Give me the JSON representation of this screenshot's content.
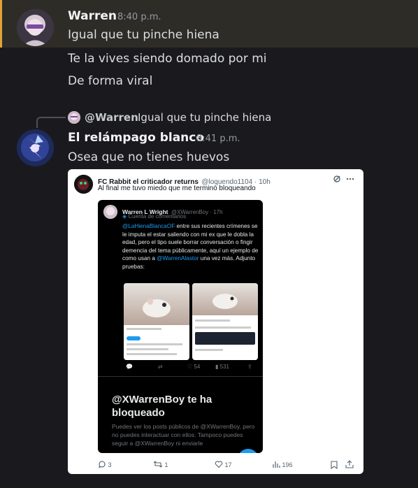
{
  "message1": {
    "author": "Warren",
    "time": "8:40 p.m.",
    "lines": [
      "Igual que tu pinche hiena",
      "Te la vives siendo domado por mi",
      "De forma viral"
    ]
  },
  "message2": {
    "reply": {
      "author": "@Warren",
      "text": "Igual que tu pinche hiena"
    },
    "author": "El relámpago blanco",
    "time": "8:41 p.m.",
    "text": "Osea que no tienes huevos"
  },
  "embed": {
    "author_name": "FC Rabbit el criticador returns",
    "author_handle": "@loquendo1104 · 10h",
    "text": "Al final me tuvo miedo que me terminó bloqueando",
    "inner": {
      "name": "Warren L Wright",
      "handle": "@XWarrenBoy · 17h",
      "sub": "Cuenta de comentarios",
      "mention1": "@LaHienaBlancaOF",
      "body1": " entre sus recientes crímenes se le imputa el estar saliendo con mi ex que le dobla la edad, pero el tipo suele borrar conversación o fingir demencia del tema públicamente, aquí un ejemplo de como usan a ",
      "mention2": "@WarrenAlastor",
      "body2": " una vez más. Adjunto pruebas:",
      "stats": [
        "",
        "54",
        "",
        "531"
      ],
      "blocked_title": "@XWarrenBoy te ha bloqueado",
      "blocked_text": "Puedes ver los posts públicos de @XWarrenBoy, pero no puedes interactuar con ellos. Tampoco puedes seguir a @XWarrenBoy ni enviarle"
    },
    "actions": {
      "replies": "3",
      "reposts": "1",
      "likes": "17",
      "views": "196"
    }
  },
  "colors": {
    "accent": "#e0a43a",
    "link": "#1d9bf0",
    "background": "#1a1a1e"
  }
}
